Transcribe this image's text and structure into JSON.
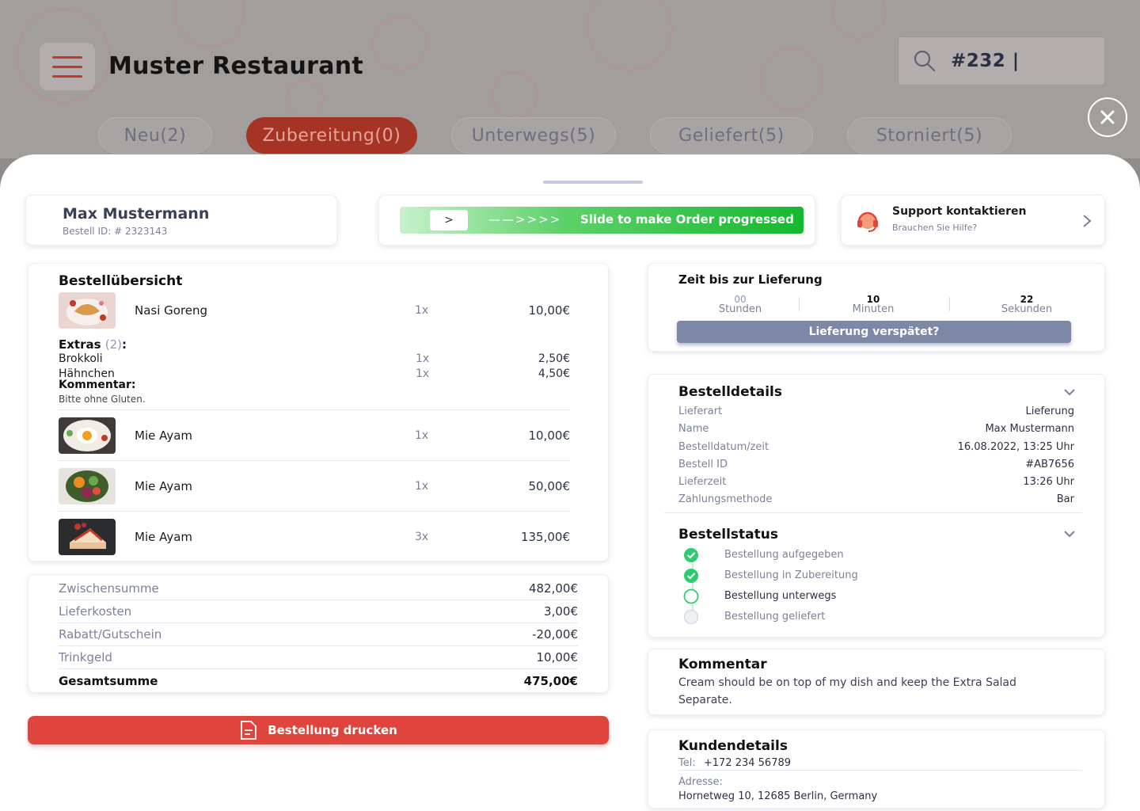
{
  "header": {
    "title": "Muster Restaurant",
    "search_value": "#232 |"
  },
  "tabs": [
    {
      "label": "Neu(2)",
      "active": false
    },
    {
      "label": "Zubereitung(0)",
      "active": true
    },
    {
      "label": "Unterwegs(5)",
      "active": false
    },
    {
      "label": "Geliefert(5)",
      "active": false
    },
    {
      "label": "Storniert(5)",
      "active": false
    }
  ],
  "customer": {
    "name": "Max Mustermann",
    "order_id": "Bestell ID: # 2323143"
  },
  "slider": {
    "knob": ">",
    "arrows": "——>>>>",
    "label": "Slide to make Order progressed"
  },
  "support": {
    "title": "Support kontaktieren",
    "subtitle": "Brauchen Sie Hilfe?"
  },
  "overview": {
    "title": "Bestellübersicht",
    "first_item": {
      "name": "Nasi Goreng",
      "qty": "1x",
      "price": "10,00€"
    },
    "extras_label": "Extras",
    "extras_count": "(2)",
    "extras_colon": ":",
    "extras": [
      {
        "name": "Brokkoli",
        "qty": "1x",
        "price": "2,50€"
      },
      {
        "name": "Hähnchen",
        "qty": "1x",
        "price": "4,50€"
      }
    ],
    "comment_label": "Kommentar:",
    "comment_text": "Bitte ohne Gluten.",
    "items": [
      {
        "name": "Mie Ayam",
        "qty": "1x",
        "price": "10,00€"
      },
      {
        "name": "Mie Ayam",
        "qty": "1x",
        "price": "50,00€"
      },
      {
        "name": "Mie Ayam",
        "qty": "3x",
        "price": "135,00€"
      }
    ]
  },
  "totals": [
    {
      "label": "Zwischensumme",
      "value": "482,00€"
    },
    {
      "label": "Lieferkosten",
      "value": "3,00€"
    },
    {
      "label": "Rabatt/Gutschein",
      "value": "-20,00€"
    },
    {
      "label": "Trinkgeld",
      "value": "10,00€"
    },
    {
      "label": "Gesamtsumme",
      "value": "475,00€"
    }
  ],
  "print_label": "Bestellung drucken",
  "delivery_time": {
    "title": "Zeit bis zur Lieferung",
    "units": [
      {
        "value": "00",
        "label": "Stunden"
      },
      {
        "value": "10",
        "label": "Minuten"
      },
      {
        "value": "22",
        "label": "Sekunden"
      }
    ],
    "late_button": "Lieferung verspätet?"
  },
  "details": {
    "title": "Bestelldetails",
    "rows": [
      {
        "key": "Lieferart",
        "value": "Lieferung"
      },
      {
        "key": "Name",
        "value": "Max Mustermann"
      },
      {
        "key": "Bestelldatum/zeit",
        "value": "16.08.2022, 13:25 Uhr"
      },
      {
        "key": "Bestell ID",
        "value": "#AB7656"
      },
      {
        "key": "Lieferzeit",
        "value": "13:26 Uhr"
      },
      {
        "key": "Zahlungsmethode",
        "value": "Bar"
      }
    ],
    "status_title": "Bestellstatus",
    "status_steps": [
      {
        "label": "Bestellung aufgegeben",
        "state": "done"
      },
      {
        "label": "Bestellung in Zubereitung",
        "state": "done"
      },
      {
        "label": "Bestellung unterwegs",
        "state": "current"
      },
      {
        "label": "Bestellung geliefert",
        "state": "pending"
      }
    ]
  },
  "comment": {
    "title": "Kommentar",
    "text": "Cream should be on top of my dish and keep the Extra Salad Separate."
  },
  "customer_details": {
    "title": "Kundendetails",
    "tel_label": "Tel:",
    "tel": "+172 234 56789",
    "address_label": "Adresse:",
    "address": "Hornetweg 10, 12685 Berlin, Germany"
  },
  "colors": {
    "accent_red": "#e0453d",
    "active_tab": "#a53427",
    "success_green": "#2ecc71",
    "slate_button": "#7d87a6"
  }
}
